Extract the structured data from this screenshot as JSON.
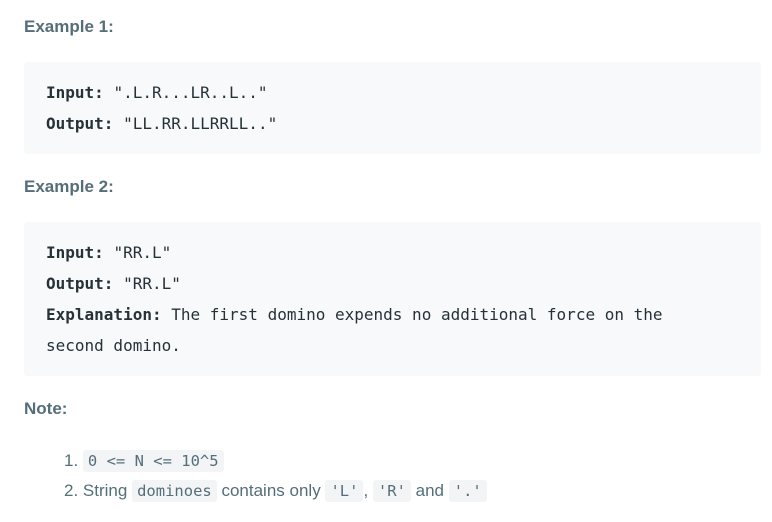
{
  "example1": {
    "heading": "Example 1:",
    "input_label": "Input:",
    "input_value": "\".L.R...LR..L..\"",
    "output_label": "Output:",
    "output_value": "\"LL.RR.LLRRLL..\""
  },
  "example2": {
    "heading": "Example 2:",
    "input_label": "Input:",
    "input_value": "\"RR.L\"",
    "output_label": "Output:",
    "output_value": "\"RR.L\"",
    "explanation_label": "Explanation:",
    "explanation_text_line1": "The first domino expends no additional force on the",
    "explanation_text_line2": "second domino."
  },
  "note": {
    "heading": "Note:",
    "item1_number": "1.",
    "item1_code": "0 <= N <= 10^5",
    "item2_number": "2.",
    "item2_text_a": "String",
    "item2_code_a": "dominoes",
    "item2_text_b": "contains only",
    "item2_code_b": "'L'",
    "item2_sep1": ",",
    "item2_code_c": "'R'",
    "item2_text_c": "and",
    "item2_code_d": "'.'"
  }
}
